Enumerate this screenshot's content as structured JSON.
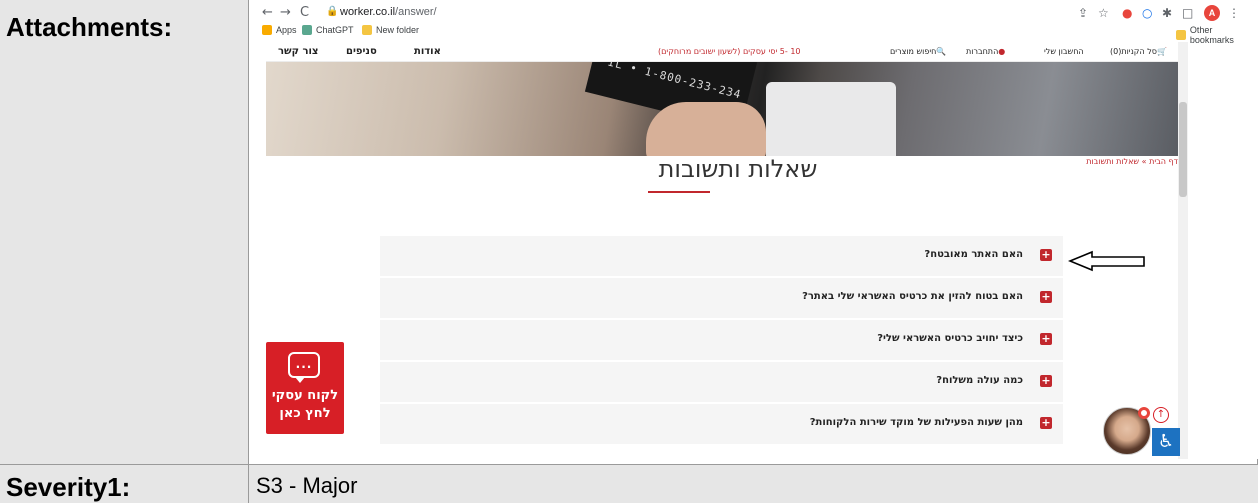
{
  "doc": {
    "attachments_label": "Attachments:",
    "severity_label": "Severity1:",
    "severity_value": "S3 - Major"
  },
  "browser": {
    "back": "←",
    "forward": "→",
    "reload": "C",
    "url_domain": "worker.co.il",
    "url_path": "/answer/",
    "bookmarks": [
      {
        "label": "Apps",
        "icon": "apps-grid-icon"
      },
      {
        "label": "ChatGPT",
        "icon": "chatgpt-icon"
      },
      {
        "label": "New folder",
        "icon": "folder-icon"
      }
    ],
    "other_bookmarks": "Other bookmarks",
    "avatar_letter": "A"
  },
  "site": {
    "nav": {
      "contact": "צור קשר",
      "branches": "סניפים",
      "about": "אודות",
      "promo": "10 -5 יסי עסקים (לשעון ישובים מרוחקים)",
      "search": "חיפוש מוצרים",
      "login": "התחברות",
      "account": "החשבון שלי",
      "cart": "סל הקניות(0)"
    },
    "hero_number": "IL • 1-800-233-234",
    "breadcrumb": "דף הבית » שאלות ותשובות",
    "title": "שאלות ותשובות",
    "faq": [
      {
        "q": "האם האתר מאובטח?"
      },
      {
        "q": "האם בטוח להזין את כרטיס האשראי שלי באתר?"
      },
      {
        "q": "כיצד יחויב כרטיס האשראי שלי?"
      },
      {
        "q": "כמה עולה משלוח?"
      },
      {
        "q": "מהן שעות הפעילות של מוקד שירות הלקוחות?"
      }
    ],
    "plus_glyph": "+",
    "business": {
      "chat_dots": "...",
      "line1": "לקוח עסקי",
      "line2": "לחץ כאן"
    },
    "up_glyph": "↑",
    "a11y_glyph": "♿"
  },
  "colors": {
    "brand_red": "#c1272d",
    "a11y_blue": "#1d72c1"
  }
}
